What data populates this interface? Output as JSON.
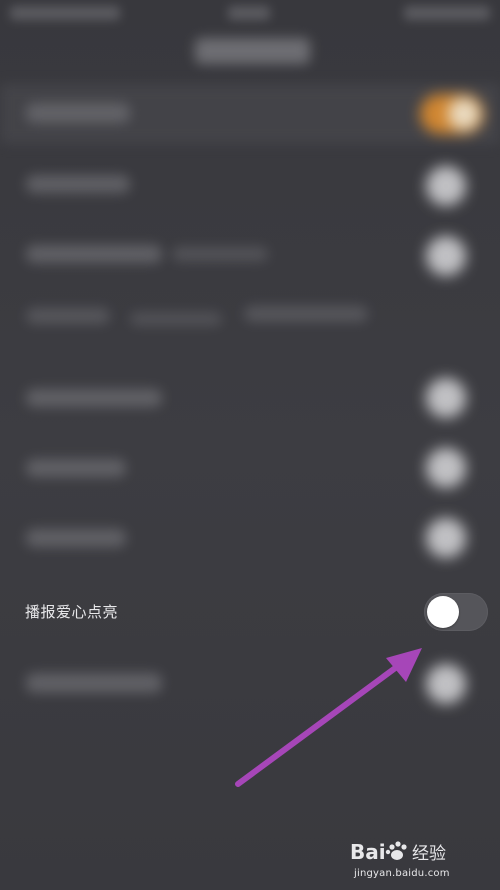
{
  "rows": {
    "love_broadcast": {
      "label": "播报爱心点亮",
      "toggle_on": false
    }
  },
  "watermark": {
    "logo_text": "Bai  经验",
    "url": "jingyan.baidu.com"
  },
  "colors": {
    "background": "#3a3a3f",
    "toggle_off_track": "#55555a",
    "toggle_knob": "#ffffff",
    "toggle_on_accent": "#d88a30",
    "annotation_arrow": "#a646b8"
  },
  "icons": {
    "annotation": "arrow-annotation-icon",
    "watermark": "baidu-paw-icon"
  }
}
